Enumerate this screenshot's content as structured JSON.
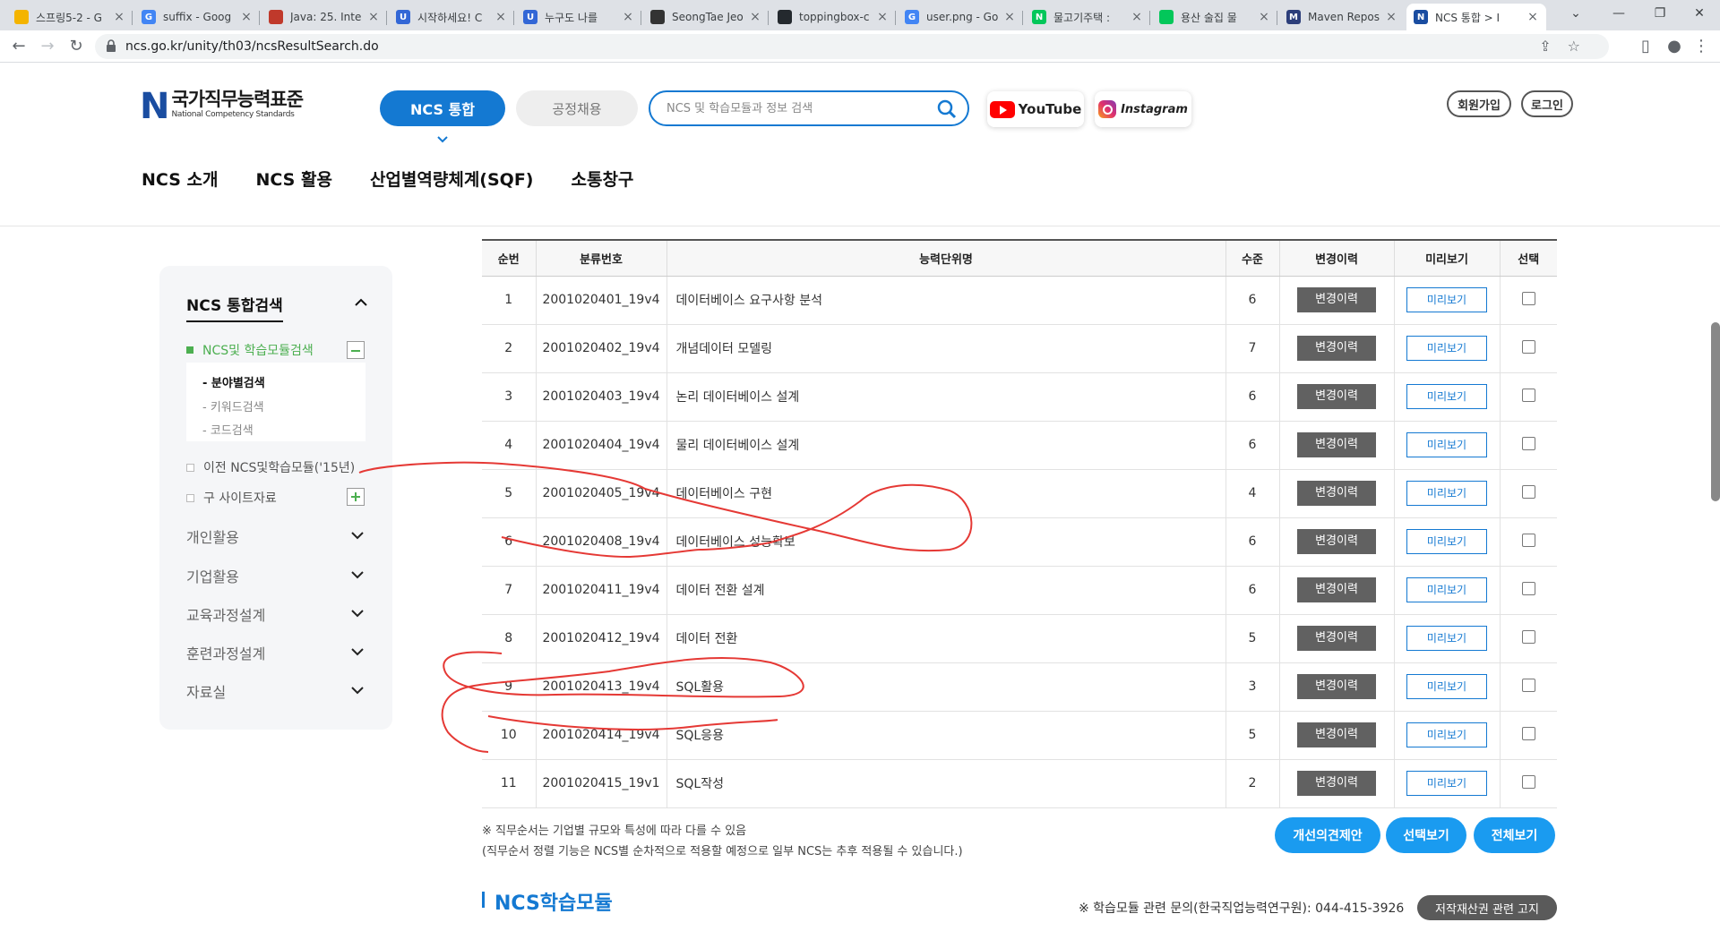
{
  "browser": {
    "tabs": [
      {
        "title": "스프링5-2 - G",
        "color": "#f4b400",
        "glyph": ""
      },
      {
        "title": "suffix - Goog",
        "color": "#4285f4",
        "glyph": "G"
      },
      {
        "title": "Java: 25. Inte",
        "color": "#c0392b",
        "glyph": ""
      },
      {
        "title": "시작하세요! C",
        "color": "#3367d6",
        "glyph": "U"
      },
      {
        "title": "누구도 나를 ",
        "color": "#3367d6",
        "glyph": "U"
      },
      {
        "title": "SeongTae Jeo",
        "color": "#333333",
        "glyph": ""
      },
      {
        "title": "toppingbox-c",
        "color": "#24292e",
        "glyph": ""
      },
      {
        "title": "user.png - Go",
        "color": "#4285f4",
        "glyph": "G"
      },
      {
        "title": "물고기주택 :",
        "color": "#03c75a",
        "glyph": "N"
      },
      {
        "title": "용산 술집 물",
        "color": "#03c75a",
        "glyph": ""
      },
      {
        "title": "Maven Repos",
        "color": "#2c3e7a",
        "glyph": "M"
      },
      {
        "title": "NCS 통합 > I",
        "color": "#1a4da1",
        "glyph": "N"
      }
    ],
    "url": "ncs.go.kr/unity/th03/ncsResultSearch.do"
  },
  "header": {
    "logo_ko": "국가직무능력표준",
    "logo_en": "National Competency Standards",
    "tab_ncs": "NCS 통합",
    "tab_hire": "공정채용",
    "search_placeholder": "NCS 및 학습모듈과 정보 검색",
    "youtube": "YouTube",
    "instagram": "Instagram",
    "signup": "회원가입",
    "login": "로그인",
    "gnb": [
      "NCS 소개",
      "NCS 활용",
      "산업별역량체계(SQF)",
      "소통창구"
    ]
  },
  "sidebar": {
    "title": "NCS 통합검색",
    "sub_active": "NCS및 학습모듈검색",
    "sub_items": [
      "분야별검색",
      "키워드검색",
      "코드검색"
    ],
    "extra_items": [
      "이전 NCS및학습모듈('15년)",
      "구 사이트자료"
    ],
    "menus": [
      "개인활용",
      "기업활용",
      "교육과정설계",
      "훈련과정설계",
      "자료실"
    ]
  },
  "table": {
    "headers": [
      "순번",
      "분류번호",
      "능력단위명",
      "수준",
      "변경이력",
      "미리보기",
      "선택"
    ],
    "history_label": "변경이력",
    "preview_label": "미리보기",
    "rows": [
      {
        "no": "1",
        "code": "2001020401_19v4",
        "name": "데이터베이스 요구사항 분석",
        "level": "6"
      },
      {
        "no": "2",
        "code": "2001020402_19v4",
        "name": "개념데이터 모델링",
        "level": "7"
      },
      {
        "no": "3",
        "code": "2001020403_19v4",
        "name": "논리 데이터베이스 설계",
        "level": "6"
      },
      {
        "no": "4",
        "code": "2001020404_19v4",
        "name": "물리 데이터베이스 설계",
        "level": "6"
      },
      {
        "no": "5",
        "code": "2001020405_19v4",
        "name": "데이터베이스 구현",
        "level": "4"
      },
      {
        "no": "6",
        "code": "2001020408_19v4",
        "name": "데이터베이스 성능확보",
        "level": "6"
      },
      {
        "no": "7",
        "code": "2001020411_19v4",
        "name": "데이터 전환 설계",
        "level": "6"
      },
      {
        "no": "8",
        "code": "2001020412_19v4",
        "name": "데이터 전환",
        "level": "5"
      },
      {
        "no": "9",
        "code": "2001020413_19v4",
        "name": "SQL활용",
        "level": "3"
      },
      {
        "no": "10",
        "code": "2001020414_19v4",
        "name": "SQL응용",
        "level": "5"
      },
      {
        "no": "11",
        "code": "2001020415_19v1",
        "name": "SQL작성",
        "level": "2"
      }
    ]
  },
  "notes": {
    "line1": "※ 직무순서는 기업별 규모와 특성에 따라 다를 수 있음",
    "line2": "(직무순서 정렬 기능은 NCS별 순차적으로 적용할 예정으로 일부 NCS는 추후 적용될 수 있습니다.)"
  },
  "actions": {
    "suggest": "개선의견제안",
    "view_selected": "선택보기",
    "view_all": "전체보기"
  },
  "module_section": {
    "title": "NCS학습모듈",
    "inquiry": "※ 학습모듈 관련 문의(한국직업능력연구원): 044-415-3926",
    "copyright": "저작재산권 관련 고지"
  }
}
